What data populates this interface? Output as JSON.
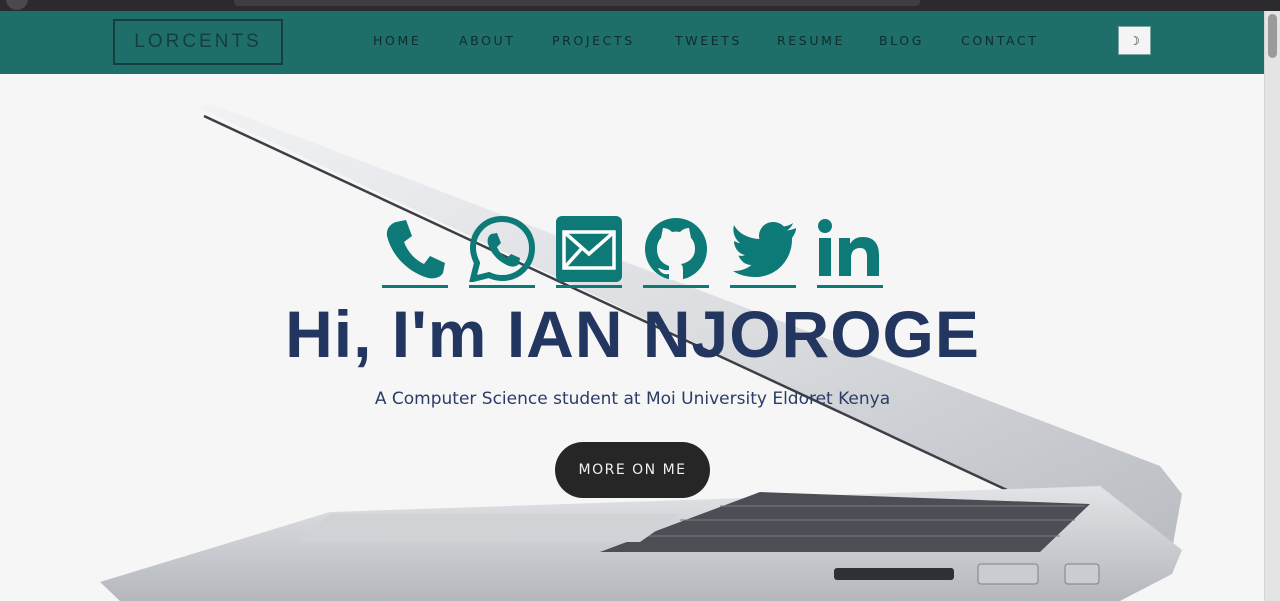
{
  "navbar": {
    "brand": "LORCENTS",
    "items": [
      {
        "label": "HOME"
      },
      {
        "label": "ABOUT"
      },
      {
        "label": "PROJECTS"
      },
      {
        "label": "TWEETS"
      },
      {
        "label": "RESUME"
      },
      {
        "label": "BLOG"
      },
      {
        "label": "CONTACT"
      }
    ],
    "theme_toggle_icon": "moon-icon"
  },
  "hero": {
    "socials": [
      {
        "icon": "phone-icon"
      },
      {
        "icon": "whatsapp-icon"
      },
      {
        "icon": "email-icon"
      },
      {
        "icon": "github-icon"
      },
      {
        "icon": "twitter-icon"
      },
      {
        "icon": "linkedin-icon"
      }
    ],
    "greeting": "Hi, I'm ",
    "name": "IAN NJOROGE",
    "subtitle": "A Computer Science student at Moi University Eldoret Kenya",
    "cta_label": "MORE ON ME"
  },
  "colors": {
    "navbar_bg": "#1e6e6a",
    "accent": "#0d7a78",
    "headline": "#223660",
    "button_bg": "#262626"
  }
}
